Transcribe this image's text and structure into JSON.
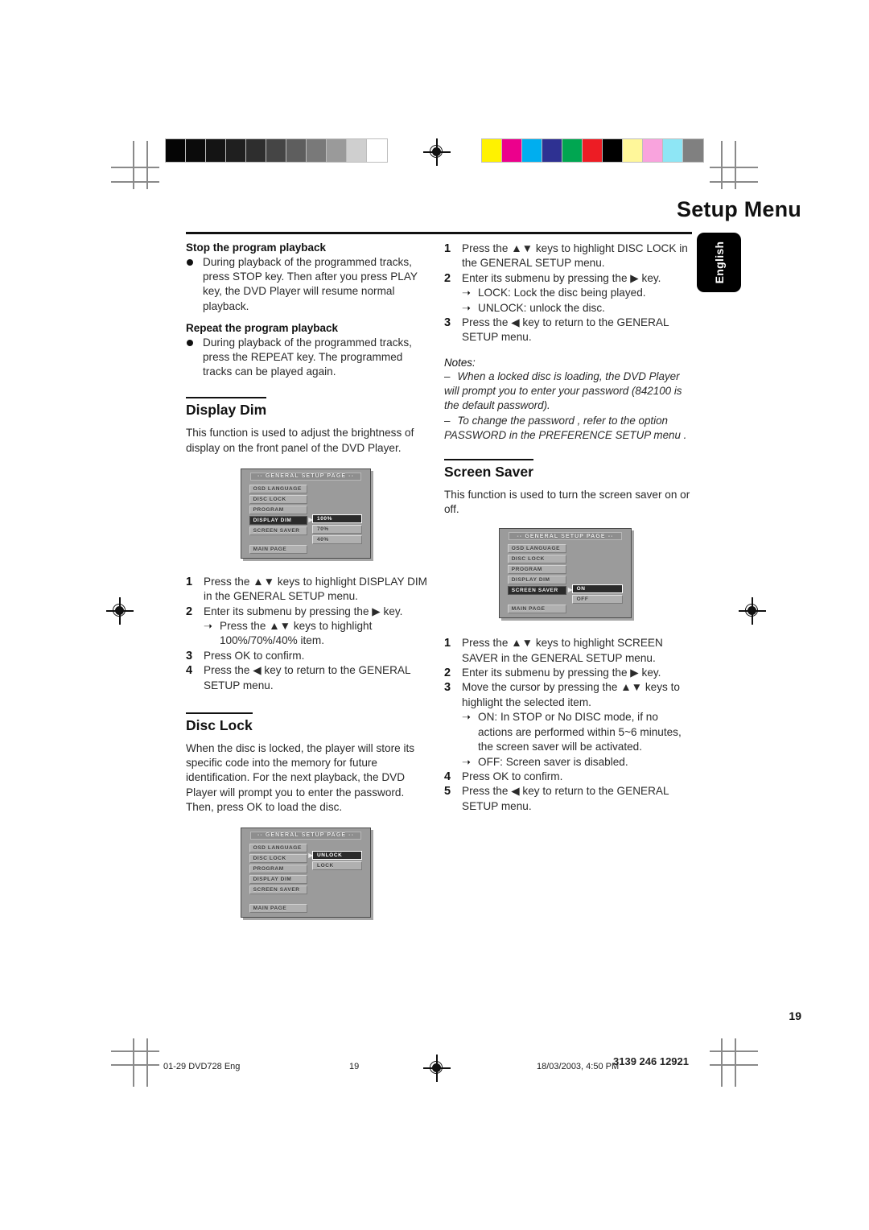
{
  "header": {
    "title": "Setup Menu",
    "language_tab": "English"
  },
  "left_column": {
    "blocks": [
      {
        "type": "subhead",
        "title": "Stop the program playback",
        "bullets": [
          "During playback of the programmed tracks, press STOP key. Then after you press PLAY key, the DVD Player will resume normal playback."
        ]
      },
      {
        "type": "subhead",
        "title": "Repeat the program playback",
        "bullets": [
          "During playback of the programmed tracks, press the REPEAT key. The programmed tracks can be played again."
        ]
      }
    ],
    "display_dim": {
      "heading": "Display Dim",
      "body": "This function is used to adjust the brightness of display on the front panel of the DVD Player.",
      "steps": [
        {
          "num": "1",
          "text": "Press the ▲▼ keys to highlight  DISPLAY DIM in the GENERAL SETUP menu."
        },
        {
          "num": "2",
          "text": "Enter its submenu by pressing the ▶  key."
        },
        {
          "num": "",
          "arrow": "Press the ▲▼ keys to highlight 100%/70%/40% item."
        },
        {
          "num": "3",
          "text": "Press OK to confirm."
        },
        {
          "num": "4",
          "text": "Press the ◀ key to return to the GENERAL SETUP menu."
        }
      ]
    },
    "disc_lock": {
      "heading": "Disc Lock",
      "body": "When the disc is locked, the player will store its specific code into the memory for future identification. For the next playback, the DVD Player will prompt you to enter the password. Then, press OK to load the disc."
    }
  },
  "right_column": {
    "disc_lock_steps": [
      {
        "num": "1",
        "text": "Press the ▲▼ keys to highlight DISC LOCK in the GENERAL SETUP menu."
      },
      {
        "num": "2",
        "text": "Enter its submenu by pressing the ▶  key."
      },
      {
        "num": "",
        "arrow": "LOCK: Lock the disc being played."
      },
      {
        "num": "",
        "arrow": "UNLOCK: unlock the disc."
      },
      {
        "num": "3",
        "text": "Press the ◀ key to return to the GENERAL SETUP menu."
      }
    ],
    "notes": {
      "title": "Notes:",
      "items": [
        "When a locked disc is loading, the DVD Player will prompt you to enter your password (842100 is the default password).",
        "To change the password , refer to the option PASSWORD in the PREFERENCE SETUP menu ."
      ]
    },
    "screen_saver": {
      "heading": "Screen Saver",
      "body": "This function is used to turn the screen saver on or off.",
      "steps": [
        {
          "num": "1",
          "text": "Press the ▲▼ keys to highlight SCREEN SAVER in the GENERAL SETUP menu."
        },
        {
          "num": "2",
          "text": "Enter its submenu by pressing the ▶ key."
        },
        {
          "num": "3",
          "text": "Move the cursor by pressing the ▲▼ keys to highlight the selected item."
        },
        {
          "num": "",
          "arrow": "ON: In STOP or No DISC mode, if no actions are performed within 5~6 minutes, the screen saver will be activated."
        },
        {
          "num": "",
          "arrow": "OFF: Screen saver is disabled."
        },
        {
          "num": "4",
          "text": "Press OK to confirm."
        },
        {
          "num": "5",
          "text": "Press the ◀ key to return to the GENERAL SETUP menu."
        }
      ]
    }
  },
  "osd_screens": {
    "display_dim": {
      "title": "-- GENERAL SETUP PAGE --",
      "items": [
        "OSD LANGUAGE",
        "DISC LOCK",
        "PROGRAM",
        "DISPLAY DIM",
        "SCREEN SAVER"
      ],
      "footer_item": "MAIN PAGE",
      "selected": "DISPLAY DIM",
      "submenu": [
        "100%",
        "70%",
        "40%"
      ],
      "submenu_selected": "100%"
    },
    "disc_lock": {
      "title": "-- GENERAL SETUP PAGE --",
      "items": [
        "OSD LANGUAGE",
        "DISC LOCK",
        "PROGRAM",
        "DISPLAY DIM",
        "SCREEN SAVER"
      ],
      "footer_item": "MAIN PAGE",
      "selected": "DISC LOCK",
      "submenu": [
        "UNLOCK",
        "LOCK"
      ],
      "submenu_selected": "UNLOCK"
    },
    "screen_saver": {
      "title": "-- GENERAL SETUP PAGE --",
      "items": [
        "OSD LANGUAGE",
        "DISC LOCK",
        "PROGRAM",
        "DISPLAY DIM",
        "SCREEN SAVER"
      ],
      "footer_item": "MAIN PAGE",
      "selected": "SCREEN SAVER",
      "submenu": [
        "ON",
        "OFF"
      ],
      "submenu_selected": "ON"
    }
  },
  "footer": {
    "file_label": "01-29 DVD728 Eng",
    "page_number_footer": "19",
    "timestamp": "18/03/2003, 4:50 PM",
    "doc_code": "3139 246 12921",
    "folio": "19"
  },
  "color_bars": {
    "grayscale": [
      "#050505",
      "#0b0b0b",
      "#141414",
      "#1f1f1f",
      "#2e2e2e",
      "#454545",
      "#5e5e5e",
      "#797979",
      "#9a9a9a",
      "#cfcfcf",
      "#ffffff"
    ],
    "colors": [
      "#fff200",
      "#ec008c",
      "#00aeef",
      "#2e3192",
      "#00a651",
      "#ed1c24",
      "#000000",
      "#fff79a",
      "#f9a3dd",
      "#8ee6f5",
      "#808080"
    ]
  }
}
